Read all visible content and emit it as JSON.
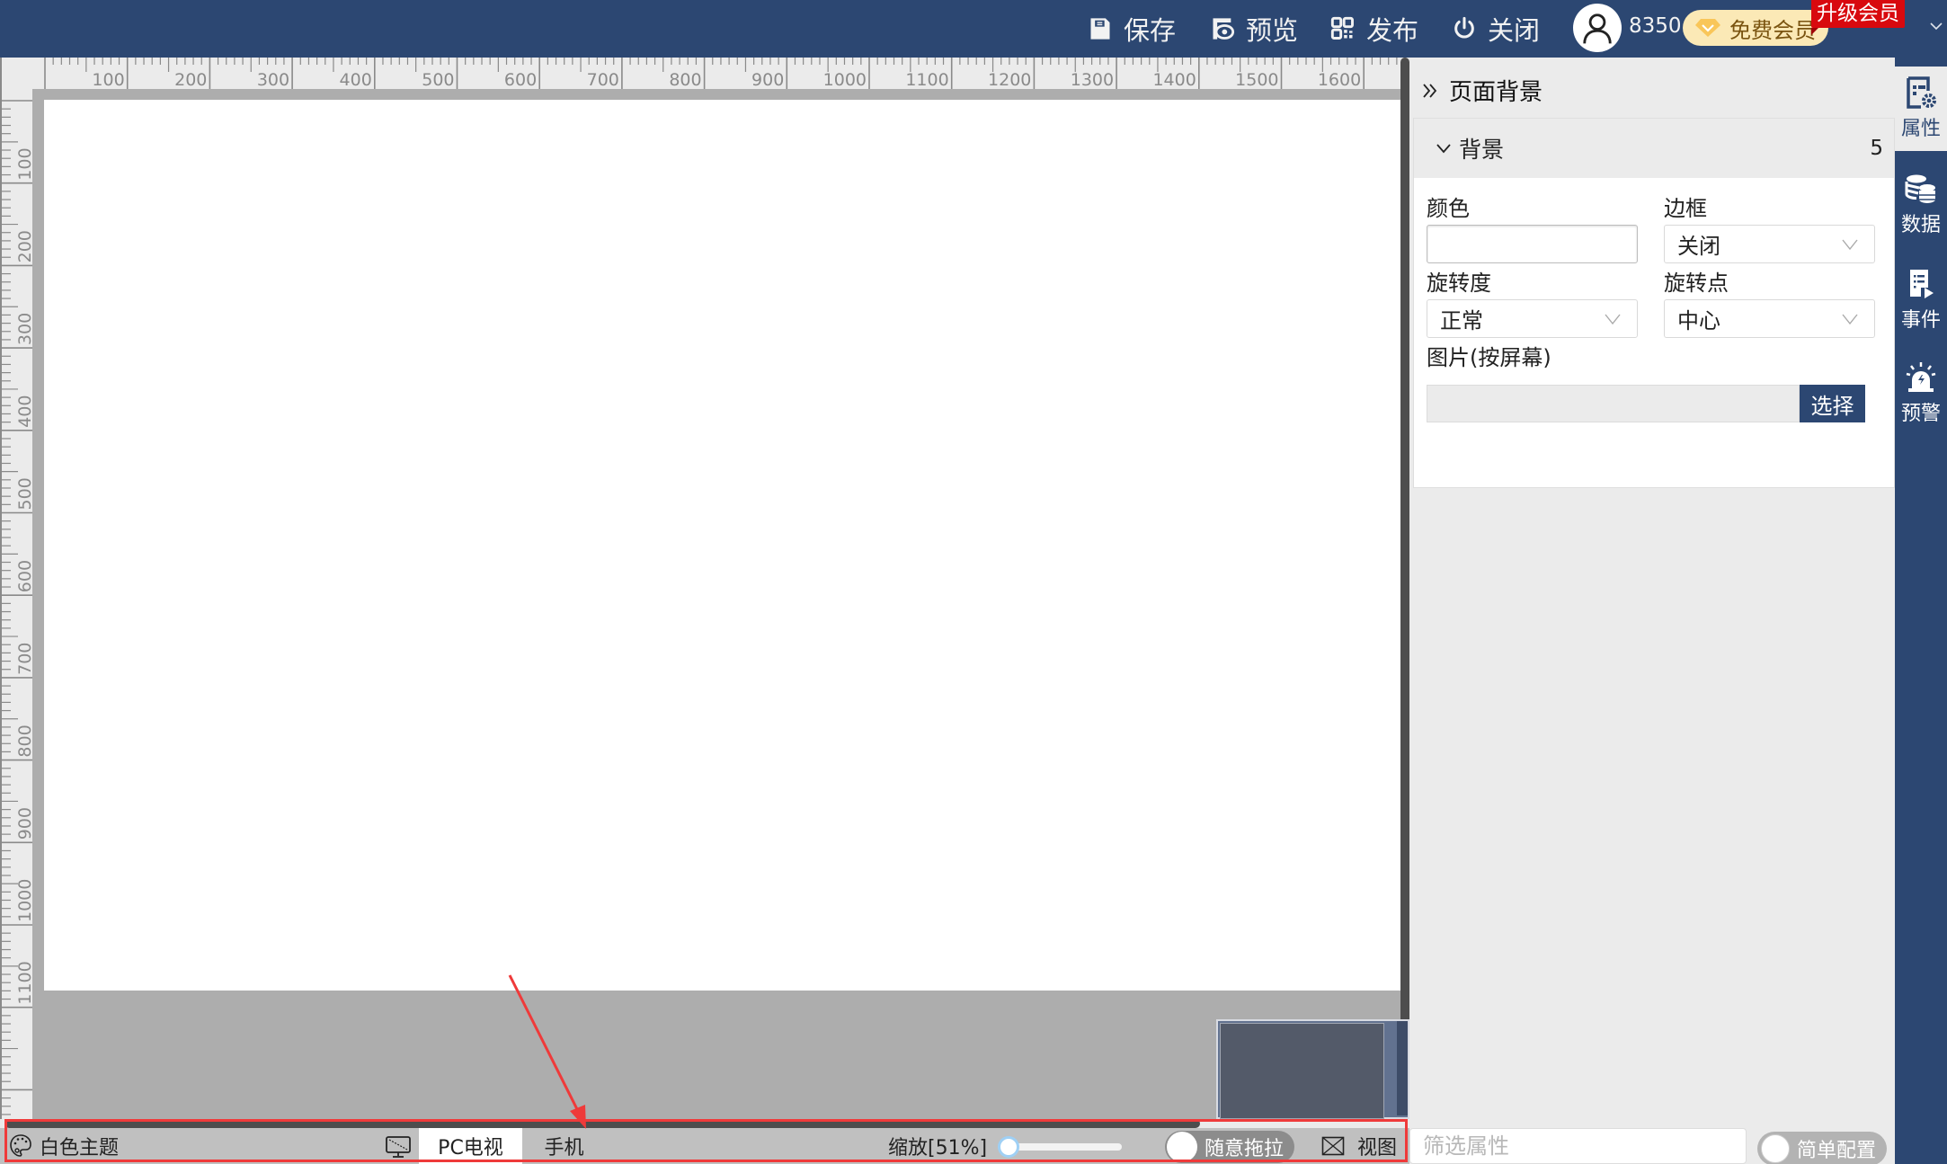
{
  "topbar": {
    "actions": [
      {
        "icon": "save-icon",
        "label": "保存"
      },
      {
        "icon": "preview-icon",
        "label": "预览"
      },
      {
        "icon": "publish-icon",
        "label": "发布"
      },
      {
        "icon": "power-icon",
        "label": "关闭"
      }
    ],
    "user": {
      "coins": "8350",
      "membership": "免费会员",
      "upgrade_label": "升级会员"
    },
    "colors": {
      "bar": "#2c4772",
      "upgrade": "#d8090e",
      "member_bg": "#fbe9b6"
    }
  },
  "rulers": {
    "top_labels": [
      "100",
      "200",
      "300",
      "400",
      "500",
      "600",
      "700",
      "800",
      "900",
      "1000",
      "1100",
      "1200",
      "1300",
      "1400",
      "1500",
      "1600"
    ],
    "left_labels": [
      "100",
      "200",
      "300",
      "400",
      "500",
      "600",
      "700",
      "800",
      "900",
      "1000",
      "1100"
    ]
  },
  "bottombar": {
    "theme_label": "白色主题",
    "device_tabs": [
      {
        "label": "PC电视",
        "active": true
      },
      {
        "label": "手机",
        "active": false
      }
    ],
    "zoom_label": "缩放[51%]",
    "zoom_percent": 51,
    "drag_toggle_label": "随意拖拉",
    "view_label": "视图"
  },
  "panel": {
    "title": "页面背景",
    "section": {
      "title": "背景",
      "count": "5",
      "fields": {
        "color_label": "颜色",
        "color_value": "",
        "border_label": "边框",
        "border_value": "关闭",
        "rotation_label": "旋转度",
        "rotation_value": "正常",
        "pivot_label": "旋转点",
        "pivot_value": "中心",
        "image_label": "图片(按屏幕)",
        "image_value": "",
        "choose_label": "选择"
      }
    },
    "filter_placeholder": "筛选属性",
    "simple_config_label": "简单配置"
  },
  "iconbar": {
    "items": [
      {
        "icon": "properties-icon",
        "label": "属性",
        "active": true
      },
      {
        "icon": "database-icon",
        "label": "数据",
        "active": false
      },
      {
        "icon": "event-icon",
        "label": "事件",
        "active": false
      },
      {
        "icon": "alarm-icon",
        "label": "预警",
        "active": false
      }
    ]
  }
}
